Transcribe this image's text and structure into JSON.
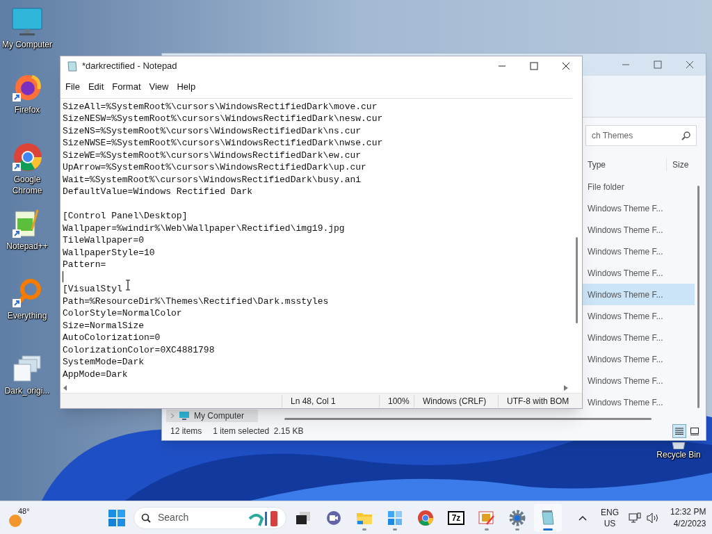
{
  "desktop_icons": [
    {
      "kind": "computer",
      "label": "My Computer"
    },
    {
      "kind": "firefox",
      "label": "Firefox"
    },
    {
      "kind": "chrome",
      "label": "Google Chrome"
    },
    {
      "kind": "notepadpp",
      "label": "Notepad++"
    },
    {
      "kind": "everything",
      "label": "Everything"
    },
    {
      "kind": "images",
      "label": "Dark_origi..."
    }
  ],
  "recycle_bin": {
    "label": "Recycle Bin"
  },
  "explorer": {
    "search": {
      "placeholder": "ch Themes"
    },
    "columns": [
      "Type",
      "Size"
    ],
    "rows": [
      {
        "type": "File folder",
        "selected": false
      },
      {
        "type": "Windows Theme F...",
        "selected": false
      },
      {
        "type": "Windows Theme F...",
        "selected": false
      },
      {
        "type": "Windows Theme F...",
        "selected": false
      },
      {
        "type": "Windows Theme F...",
        "selected": false
      },
      {
        "type": "Windows Theme F...",
        "selected": true
      },
      {
        "type": "Windows Theme F...",
        "selected": false
      },
      {
        "type": "Windows Theme F...",
        "selected": false
      },
      {
        "type": "Windows Theme F...",
        "selected": false
      },
      {
        "type": "Windows Theme F...",
        "selected": false
      },
      {
        "type": "Windows Theme F...",
        "selected": false
      }
    ],
    "nav_item": "My Computer",
    "status": {
      "items": "12 items",
      "selection": "1 item selected  2.15 KB"
    }
  },
  "notepad": {
    "title": "*darkrectified - Notepad",
    "menu": [
      "File",
      "Edit",
      "Format",
      "View",
      "Help"
    ],
    "lines": [
      {
        "kind": "text",
        "text": "SizeAll=%SystemRoot%\\cursors\\WindowsRectifiedDark\\move.cur"
      },
      {
        "kind": "text",
        "text": "SizeNESW=%SystemRoot%\\cursors\\WindowsRectifiedDark\\nesw.cur"
      },
      {
        "kind": "text",
        "text": "SizeNS=%SystemRoot%\\cursors\\WindowsRectifiedDark\\ns.cur"
      },
      {
        "kind": "text",
        "text": "SizeNWSE=%SystemRoot%\\cursors\\WindowsRectifiedDark\\nwse.cur"
      },
      {
        "kind": "text",
        "text": "SizeWE=%SystemRoot%\\cursors\\WindowsRectifiedDark\\ew.cur"
      },
      {
        "kind": "text",
        "text": "UpArrow=%SystemRoot%\\cursors\\WindowsRectifiedDark\\up.cur"
      },
      {
        "kind": "text",
        "text": "Wait=%SystemRoot%\\cursors\\WindowsRectifiedDark\\busy.ani"
      },
      {
        "kind": "text",
        "text": "DefaultValue=Windows Rectified Dark"
      },
      {
        "kind": "blank"
      },
      {
        "kind": "text",
        "text": "[Control Panel\\Desktop]"
      },
      {
        "kind": "text",
        "text": "Wallpaper=%windir%\\Web\\Wallpaper\\Rectified\\img19.jpg"
      },
      {
        "kind": "text",
        "text": "TileWallpaper=0"
      },
      {
        "kind": "text",
        "text": "WallpaperStyle=10"
      },
      {
        "kind": "text",
        "text": "Pattern="
      },
      {
        "kind": "caret"
      },
      {
        "kind": "text",
        "text": "[VisualStyl"
      },
      {
        "kind": "text",
        "text": "Path=%ResourceDir%\\Themes\\Rectified\\Dark.msstyles"
      },
      {
        "kind": "text",
        "text": "ColorStyle=NormalColor"
      },
      {
        "kind": "text",
        "text": "Size=NormalSize"
      },
      {
        "kind": "text",
        "text": "AutoColorization=0"
      },
      {
        "kind": "text",
        "text": "ColorizationColor=0XC4881798"
      },
      {
        "kind": "text",
        "text": "SystemMode=Dark"
      },
      {
        "kind": "text",
        "text": "AppMode=Dark"
      }
    ],
    "status": [
      "Ln 48, Col 1",
      "100%",
      "Windows (CRLF)",
      "UTF-8 with BOM"
    ]
  },
  "taskbar": {
    "weather": "48°",
    "search": {
      "placeholder": "Search"
    },
    "apps": [
      {
        "kind": "taskview",
        "running": false,
        "active": false
      },
      {
        "kind": "chat",
        "running": false,
        "active": false
      },
      {
        "kind": "folder",
        "running": true,
        "active": false
      },
      {
        "kind": "store",
        "running": true,
        "active": false
      },
      {
        "kind": "chrome",
        "running": false,
        "active": false
      },
      {
        "kind": "sevenzip",
        "label": "7z",
        "running": false,
        "active": false
      },
      {
        "kind": "paint",
        "running": true,
        "active": false
      },
      {
        "kind": "settings",
        "running": true,
        "active": false
      },
      {
        "kind": "notepad",
        "running": true,
        "active": true
      }
    ],
    "language": [
      "ENG",
      "US"
    ],
    "time": "12:32 PM",
    "date": "4/2/2023"
  }
}
